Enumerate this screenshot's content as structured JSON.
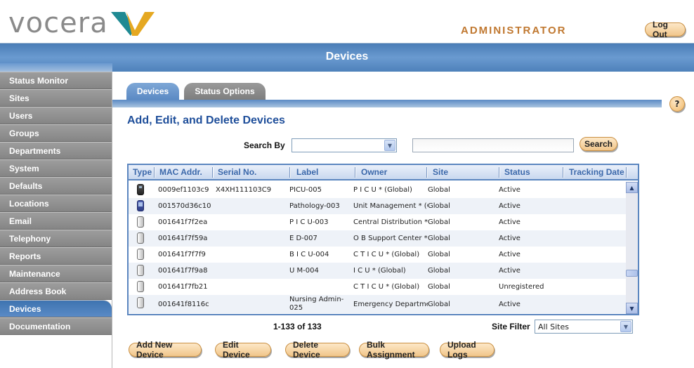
{
  "brand": {
    "logo_text": "vocera"
  },
  "header": {
    "role_label": "ADMINISTRATOR",
    "logout_label": "Log Out"
  },
  "titlebar": {
    "title": "Devices"
  },
  "sidebar": {
    "items": [
      {
        "label": "Status Monitor"
      },
      {
        "label": "Sites"
      },
      {
        "label": "Users"
      },
      {
        "label": "Groups"
      },
      {
        "label": "Departments"
      },
      {
        "label": "System"
      },
      {
        "label": "Defaults"
      },
      {
        "label": "Locations"
      },
      {
        "label": "Email"
      },
      {
        "label": "Telephony"
      },
      {
        "label": "Reports"
      },
      {
        "label": "Maintenance"
      },
      {
        "label": "Address Book"
      },
      {
        "label": "Devices",
        "active": true
      },
      {
        "label": "Documentation"
      }
    ]
  },
  "tabs": [
    {
      "label": "Devices",
      "active": true
    },
    {
      "label": "Status Options"
    }
  ],
  "help_label": "?",
  "main": {
    "heading": "Add, Edit, and Delete Devices",
    "search": {
      "label": "Search By",
      "selected": "",
      "query": "",
      "button_label": "Search"
    },
    "table": {
      "columns": [
        "Type",
        "MAC Addr.",
        "Serial No.",
        "Label",
        "Owner",
        "Site",
        "Status",
        "Tracking Date"
      ],
      "rows": [
        {
          "type": "phone",
          "mac": "0009ef1103c9",
          "serial": "X4XH111103C9",
          "label": "PICU-005",
          "owner": "P I C U * (Global)",
          "site": "Global",
          "status": "Active",
          "tracking": ""
        },
        {
          "type": "pda",
          "mac": "001570d36c10",
          "serial": "",
          "label": "Pathology-003",
          "owner": "Unit Management * (G",
          "site": "Global",
          "status": "Active",
          "tracking": ""
        },
        {
          "type": "badge",
          "mac": "001641f7f2ea",
          "serial": "",
          "label": "P I C U-003",
          "owner": "Central Distribution * (",
          "site": "Global",
          "status": "Active",
          "tracking": ""
        },
        {
          "type": "badge",
          "mac": "001641f7f59a",
          "serial": "",
          "label": "E D-007",
          "owner": "O B Support Center * (",
          "site": "Global",
          "status": "Active",
          "tracking": ""
        },
        {
          "type": "badge",
          "mac": "001641f7f7f9",
          "serial": "",
          "label": "B I C U-004",
          "owner": "C T I C U * (Global)",
          "site": "Global",
          "status": "Active",
          "tracking": ""
        },
        {
          "type": "badge",
          "mac": "001641f7f9a8",
          "serial": "",
          "label": "U M-004",
          "owner": "I C U * (Global)",
          "site": "Global",
          "status": "Active",
          "tracking": ""
        },
        {
          "type": "badge",
          "mac": "001641f7fb21",
          "serial": "",
          "label": "",
          "owner": "C T I C U * (Global)",
          "site": "Global",
          "status": "Unregistered",
          "tracking": ""
        },
        {
          "type": "badge",
          "mac": "001641f8116c",
          "serial": "",
          "label": "Nursing Admin-025",
          "owner": "Emergency Departmen",
          "site": "Global",
          "status": "Active",
          "tracking": ""
        }
      ]
    },
    "range_text": "1-133 of 133",
    "site_filter": {
      "label": "Site Filter",
      "selected": "All Sites"
    },
    "actions": {
      "add": "Add New Device",
      "edit": "Edit Device",
      "delete": "Delete Device",
      "bulk": "Bulk Assignment",
      "upload": "Upload Logs"
    }
  },
  "colors": {
    "accent_blue": "#5b8ac4",
    "heading_blue": "#1e4e9a",
    "admin_orange": "#c07830",
    "button_orange": "#f1c68a"
  }
}
